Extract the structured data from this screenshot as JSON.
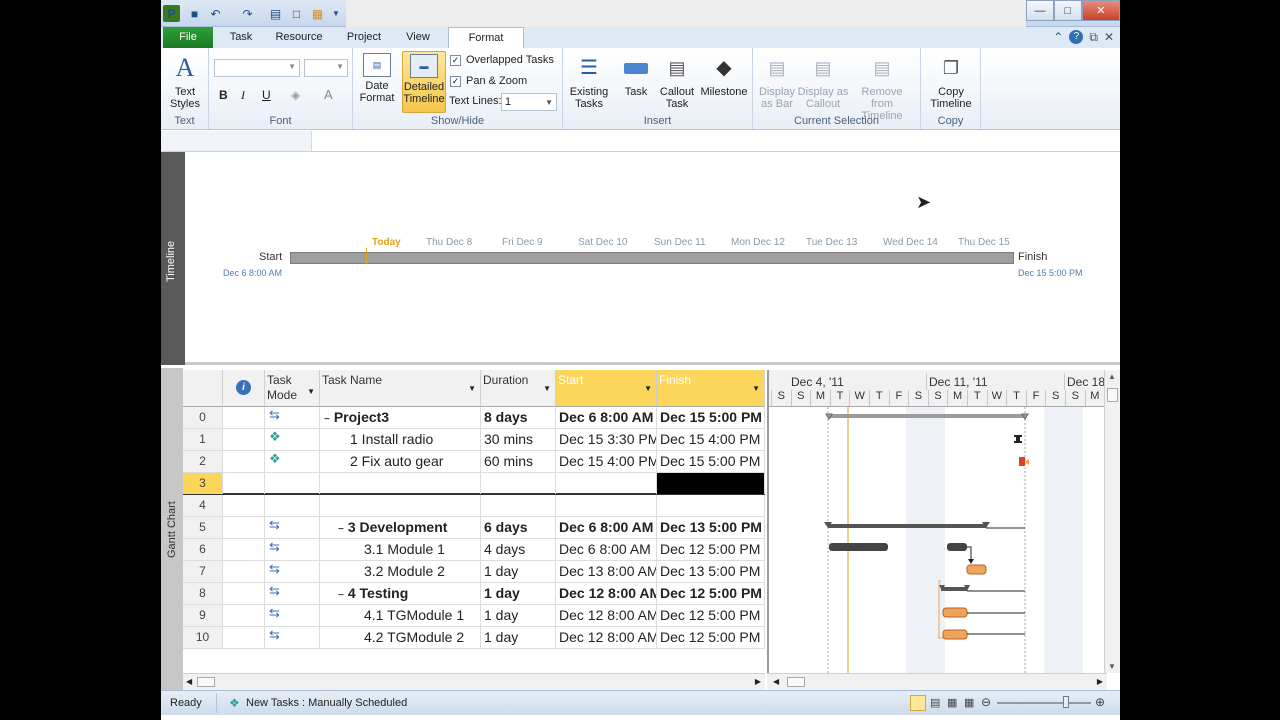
{
  "titlebar": {
    "qat_icons": [
      "project-logo-icon",
      "save-icon",
      "undo-icon",
      "redo-icon",
      "print-icon",
      "new-icon",
      "open-icon"
    ]
  },
  "tabs": [
    {
      "label": "File"
    },
    {
      "label": "Task"
    },
    {
      "label": "Resource"
    },
    {
      "label": "Project"
    },
    {
      "label": "View"
    },
    {
      "label": "Format",
      "active": true
    }
  ],
  "ribbon": {
    "text_styles": "Text Styles",
    "text_group": "Text",
    "font_group": "Font",
    "date_format": "Date Format",
    "detailed_timeline": "Detailed Timeline",
    "overlapped_tasks": "Overlapped Tasks",
    "pan_zoom": "Pan & Zoom",
    "text_lines_label": "Text Lines:",
    "text_lines_value": "1",
    "showhide_group": "Show/Hide",
    "existing_tasks": "Existing Tasks",
    "task": "Task",
    "callout_task": "Callout Task",
    "milestone": "Milestone",
    "insert_group": "Insert",
    "display_as_bar": "Display as Bar",
    "display_as_callout": "Display as Callout",
    "remove_from_timeline": "Remove from Timeline",
    "current_selection_group": "Current Selection",
    "copy_timeline": "Copy Timeline",
    "copy_group": "Copy"
  },
  "timeline": {
    "side_label": "Timeline",
    "start_label": "Start",
    "finish_label": "Finish",
    "start_date": "Dec 6 8:00 AM",
    "finish_date": "Dec 15 5:00 PM",
    "days": [
      "Today",
      "Thu Dec 8",
      "Fri Dec 9",
      "Sat Dec 10",
      "Sun Dec 11",
      "Mon Dec 12",
      "Tue Dec 13",
      "Wed Dec 14",
      "Thu Dec 15"
    ]
  },
  "grid": {
    "side_label": "Gantt Chart",
    "headers": {
      "task_mode": "Task Mode",
      "task_name": "Task Name",
      "duration": "Duration",
      "start": "Start",
      "finish": "Finish"
    },
    "rows": [
      {
        "id": "0",
        "mode": "auto",
        "name": "Project3",
        "duration": "8 days",
        "start": "Dec 6 8:00 AM",
        "finish": "Dec 15 5:00 PM",
        "bold": true,
        "collapse": true,
        "indent": 0
      },
      {
        "id": "1",
        "mode": "manual",
        "name": "1 Install radio",
        "duration": "30 mins",
        "start": "Dec 15 3:30 PM",
        "finish": "Dec 15 4:00 PM",
        "bold": false,
        "indent": 1
      },
      {
        "id": "2",
        "mode": "manual",
        "name": "2 Fix auto gear",
        "duration": "60 mins",
        "start": "Dec 15 4:00 PM",
        "finish": "Dec 15 5:00 PM",
        "bold": false,
        "indent": 1
      },
      {
        "id": "3",
        "mode": "",
        "name": "",
        "duration": "",
        "start": "",
        "finish": "",
        "bold": false,
        "indent": 0,
        "selected": true
      },
      {
        "id": "4",
        "mode": "",
        "name": "",
        "duration": "",
        "start": "",
        "finish": "",
        "bold": false,
        "indent": 0
      },
      {
        "id": "5",
        "mode": "auto",
        "name": "3 Development",
        "duration": "6 days",
        "start": "Dec 6 8:00 AM",
        "finish": "Dec 13 5:00 PM",
        "bold": true,
        "collapse": true,
        "indent": 1
      },
      {
        "id": "6",
        "mode": "auto",
        "name": "3.1 Module 1",
        "duration": "4 days",
        "start": "Dec 6 8:00 AM",
        "finish": "Dec 12 5:00 PM",
        "bold": false,
        "indent": 2
      },
      {
        "id": "7",
        "mode": "auto",
        "name": "3.2 Module 2",
        "duration": "1 day",
        "start": "Dec 13 8:00 AM",
        "finish": "Dec 13 5:00 PM",
        "bold": false,
        "indent": 2
      },
      {
        "id": "8",
        "mode": "auto",
        "name": "4 Testing",
        "duration": "1 day",
        "start": "Dec 12 8:00 AM",
        "finish": "Dec 12 5:00 PM",
        "bold": true,
        "collapse": true,
        "indent": 1
      },
      {
        "id": "9",
        "mode": "auto",
        "name": "4.1 TGModule 1",
        "duration": "1 day",
        "start": "Dec 12 8:00 AM",
        "finish": "Dec 12 5:00 PM",
        "bold": false,
        "indent": 2
      },
      {
        "id": "10",
        "mode": "auto",
        "name": "4.2 TGModule 2",
        "duration": "1 day",
        "start": "Dec 12 8:00 AM",
        "finish": "Dec 12 5:00 PM",
        "bold": false,
        "indent": 2
      }
    ]
  },
  "gantt": {
    "weeks": [
      "Dec 4, '11",
      "Dec 11, '11",
      "Dec 18"
    ],
    "days": [
      "S",
      "S",
      "M",
      "T",
      "W",
      "T",
      "F",
      "S",
      "S",
      "M",
      "T",
      "W",
      "T",
      "F",
      "S",
      "S",
      "M"
    ]
  },
  "status": {
    "ready": "Ready",
    "new_tasks": "New Tasks : Manually Scheduled"
  }
}
